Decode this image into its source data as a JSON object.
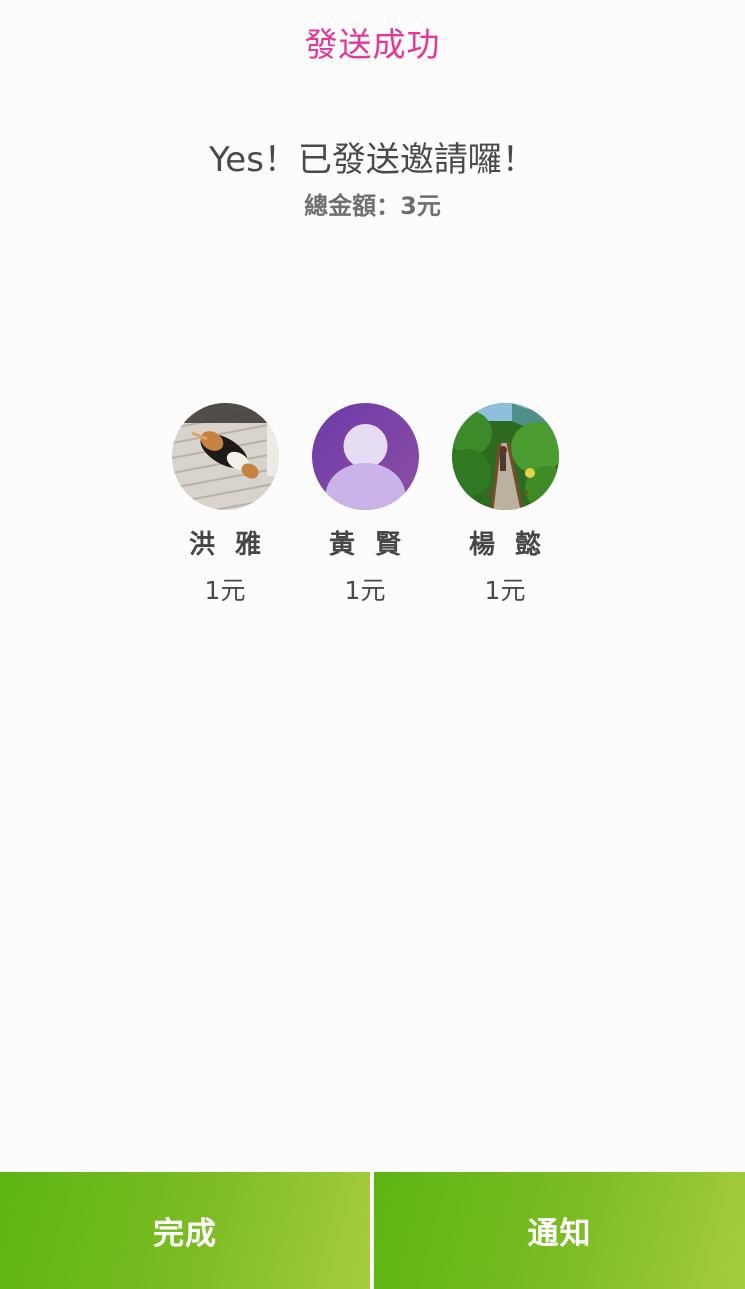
{
  "header": {
    "title": "發送成功"
  },
  "message": {
    "headline": "Yes！已發送邀請囉！",
    "total_label": "總金額：",
    "total_value": "3",
    "total_unit": "元"
  },
  "recipients": [
    {
      "name": "洪雅",
      "amount": "1元",
      "avatar": "dog-photo"
    },
    {
      "name": "黃賢",
      "amount": "1元",
      "avatar": "default-person-icon"
    },
    {
      "name": "楊懿",
      "amount": "1元",
      "avatar": "forest-path-photo"
    }
  ],
  "footer": {
    "done_label": "完成",
    "notify_label": "通知"
  },
  "colors": {
    "accent_pink": "#e8359a",
    "button_green": "#6cba1c",
    "avatar_purple": "#7b3fa8"
  }
}
